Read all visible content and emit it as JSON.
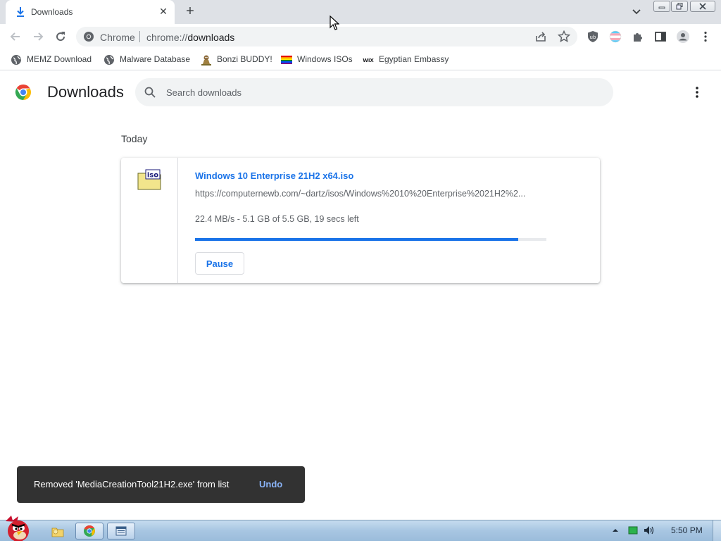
{
  "tab": {
    "title": "Downloads",
    "icon": "download-icon"
  },
  "omnibox": {
    "chip": "Chrome",
    "url_scheme": "chrome://",
    "url_path": "downloads"
  },
  "bookmarks": [
    {
      "label": "MEMZ Download",
      "icon": "globe-icon"
    },
    {
      "label": "Malware Database",
      "icon": "globe-icon"
    },
    {
      "label": "Bonzi BUDDY!",
      "icon": "bonzi-icon"
    },
    {
      "label": "Windows ISOs",
      "icon": "rainbow-flag-icon"
    },
    {
      "label": "Egyptian Embassy",
      "icon": "wix-icon"
    }
  ],
  "page": {
    "title": "Downloads",
    "search_placeholder": "Search downloads",
    "section_label": "Today"
  },
  "download": {
    "filename": "Windows 10 Enterprise 21H2 x64.iso",
    "url": "https://computernewb.com/~dartz/isos/Windows%2010%20Enterprise%2021H2%2...",
    "status": "22.4 MB/s - 5.1 GB of 5.5 GB, 19 secs left",
    "progress": 0.92,
    "pause_label": "Pause",
    "file_icon_label": "iso"
  },
  "toast": {
    "message": "Removed 'MediaCreationTool21H2.exe' from list",
    "undo_label": "Undo"
  },
  "taskbar": {
    "clock": "5:50 PM"
  },
  "colors": {
    "accent": "#1a73e8",
    "tabstrip": "#dee1e6",
    "toast_bg": "#323232"
  }
}
